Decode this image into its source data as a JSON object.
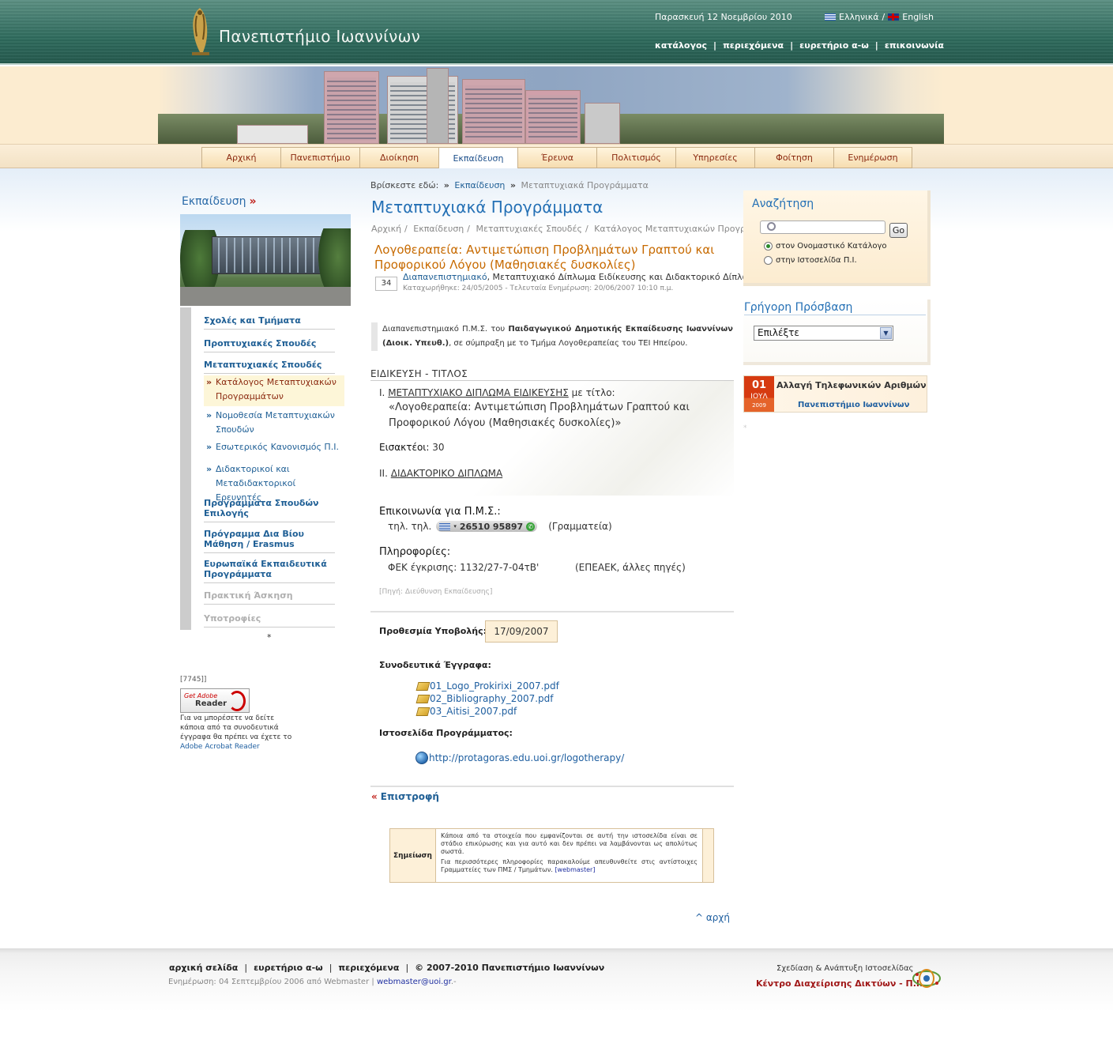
{
  "header": {
    "site_name": "Πανεπιστήμιο Ιωαννίνων",
    "date": "Παρασκευή 12 Νοεμβρίου 2010",
    "lang_greek": "Ελληνικά",
    "lang_sep": "/",
    "lang_english": "English",
    "top_nav": [
      "κατάλογος",
      "περιεχόμενα",
      "ευρετήριο α-ω",
      "επικοινωνία"
    ],
    "nav_sep": "|"
  },
  "tabs": [
    {
      "label": "Αρχική"
    },
    {
      "label": "Πανεπιστήμιο"
    },
    {
      "label": "Διοίκηση"
    },
    {
      "label": "Εκπαίδευση",
      "active": true
    },
    {
      "label": "Έρευνα"
    },
    {
      "label": "Πολιτισμός"
    },
    {
      "label": "Υπηρεσίες"
    },
    {
      "label": "Φοίτηση"
    },
    {
      "label": "Ενημέρωση"
    }
  ],
  "left": {
    "title": "Εκπαίδευση",
    "title_arrow": "»",
    "menu": [
      {
        "label": "Σχολές και Τμήματα"
      },
      {
        "label": "Προπτυχιακές Σπουδές"
      },
      {
        "label": "Μεταπτυχιακές Σπουδές"
      },
      {
        "label": "Προγράμματα Σπουδών Επιλογής"
      },
      {
        "label": "Πρόγραμμα Δια Βίου Μάθηση / Erasmus"
      },
      {
        "label": "Ευρωπαϊκά Εκπαιδευτικά Προγράμματα"
      },
      {
        "label": "Πρακτική Άσκηση",
        "disabled": true
      },
      {
        "label": "Υποτροφίες",
        "disabled": true
      }
    ],
    "submenu": [
      {
        "label": "Κατάλογος Μεταπτυχιακών Προγραμμάτων",
        "current": true
      },
      {
        "label": "Νομοθεσία Μεταπτυχιακών Σπουδών"
      },
      {
        "label": "Εσωτερικός Κανονισμός Π.Ι."
      },
      {
        "label": "Διδακτορικοί και Μεταδιδακτορικοί Ερευνητές"
      }
    ],
    "bullet": "»",
    "star": "*",
    "counter": "[7745]]",
    "adobe_get": "Get Adobe",
    "adobe_reader": "Reader",
    "adobe_note": "Για να μπορέσετε να δείτε κάποια από τα συνοδευτικά έγγραφα θα πρέπει να έχετε το",
    "adobe_link": "Adobe Acrobat Reader"
  },
  "breadcrumb": {
    "prefix": "Βρίσκεστε εδώ:",
    "sep": "»",
    "link": "Εκπαίδευση",
    "current": "Μεταπτυχιακά Προγράμματα"
  },
  "page": {
    "title": "Μεταπτυχιακά Προγράμματα",
    "path": [
      "Αρχική",
      "Εκπαίδευση",
      "Μεταπτυχιακές Σπουδές",
      "Κατάλογος Μεταπτυχιακών Προγραμμάτων"
    ],
    "path_sep": "/",
    "program_title": "Λογοθεραπεία: Αντιμετώπιση Προβλημάτων Γραπτού και Προφορικού Λόγου (Μαθησιακές δυσκολίες)",
    "count": "34",
    "meta_link": "Διαπανεπιστημιακό",
    "meta_text": ", Μεταπτυχιακό Δίπλωμα Ειδίκευσης και Διδακτορικό Δίπλωμα",
    "meta_dates": "Καταχωρήθηκε: 24/05/2005 - Τελευταία Ενημέρωση: 20/06/2007 10:10 π.μ.",
    "intro_1": "Διαπανεπιστημιακό Π.Μ.Σ. του",
    "intro_bold": "Παιδαγωγικού Δημοτικής Εκπαίδευσης Ιωαννίνων (Διοικ. Υπευθ.)",
    "intro_2": ", σε σύμπραξη με το Τμήμα Λογοθεραπείας του ΤΕΙ Ηπείρου.",
    "spec_heading": "ΕΙΔΙΚΕΥΣΗ - ΤΙΤΛΟΣ",
    "item1_num": "I.",
    "item1_link": "ΜΕΤΑΠΤΥΧΙΑΚΟ ΔΙΠΛΩΜΑ ΕΙΔΙΚΕΥΣΗΣ",
    "item1_text": "με τίτλο:",
    "degree_name": "«Λογοθεραπεία: Αντιμετώπιση Προβλημάτων Γραπτού και Προφορικού Λόγου (Μαθησιακές δυσκολίες)»",
    "admitted_label": "Εισακτέοι:",
    "admitted_value": "30",
    "item2_num": "II.",
    "item2_link": "ΔΙΔΑΚΤΟΡΙΚΟ ΔΙΠΛΩΜΑ",
    "contact_heading": "Επικοινωνία για Π.Μ.Σ.:",
    "tel_label": "τηλ. τηλ.",
    "tel_number": "26510 95897",
    "tel_note": "(Γραμματεία)",
    "info_heading": "Πληροφορίες:",
    "fek": "ΦΕΚ έγκρισης: 1132/27-7-04τΒ'",
    "fek_note": "(ΕΠΕΑΕΚ, άλλες πηγές)",
    "source": "[Πηγή: Διεύθυνση Εκπαίδευσης]",
    "deadline_label": "Προθεσμία Υποβολής:",
    "deadline_value": "17/09/2007",
    "docs_heading": "Συνοδευτικά Έγγραφα:",
    "docs": [
      "01_Logo_Prokirixi_2007.pdf",
      "02_Bibliography_2007.pdf",
      "03_Aitisi_2007.pdf"
    ],
    "web_heading": "Ιστοσελίδα Προγράμματος:",
    "web_url": "http://protagoras.edu.uoi.gr/logotherapy/",
    "back_arrow": "«",
    "back": "Επιστροφή",
    "note_label": "Σημείωση",
    "note_p1": "Κάποια από τα στοιχεία που εμφανίζονται σε αυτή την ιστοσελίδα είναι σε στάδιο επικύρωσης και για αυτό και δεν πρέπει να λαμβάνονται ως απολύτως σωστά.",
    "note_p2": "Για περισσότερες πληροφορίες παρακαλούμε απευθυνθείτε στις αντίστοιχες Γραμματείες των ΠΜΣ / Τμημάτων.",
    "note_link": "[webmaster]",
    "to_top": "^ αρχή"
  },
  "right": {
    "search_title": "Αναζήτηση",
    "go": "Go",
    "radio1": "στον Ονομαστικό Κατάλογο",
    "radio2": "στην Ιστοσελίδα Π.Ι.",
    "quick_title": "Γρήγορη Πρόσβαση",
    "quick_select": "Επιλέξτε",
    "news_day": "01",
    "news_month": "ΙΟΥΛ",
    "news_year": "2009",
    "news_title": "Αλλαγή Τηλεφωνικών Αριθμών",
    "news_sub": "Πανεπιστήμιο Ιωαννίνων",
    "star": "*"
  },
  "footer": {
    "links": [
      "αρχική σελίδα",
      "ευρετήριο α-ω",
      "περιεχόμενα",
      "© 2007-2010 Πανεπιστήμιο Ιωαννίνων"
    ],
    "sep": "|",
    "updated": "Ενημέρωση: 04 Σεπτεμβρίου 2006 από Webmaster |",
    "email": "webmaster@uoi.gr",
    "email_suffix": ".-",
    "design": "Σχεδίαση & Ανάπτυξη Ιστοσελίδας",
    "center": "Κέντρο Διαχείρισης Δικτύων - Π.Ι."
  },
  "colors": {
    "header_green": "#2f6b5d",
    "link_blue": "#1f5fa0",
    "title_blue": "#2470b5",
    "program_orange": "#c76a00",
    "accent_red": "#c0201a"
  }
}
